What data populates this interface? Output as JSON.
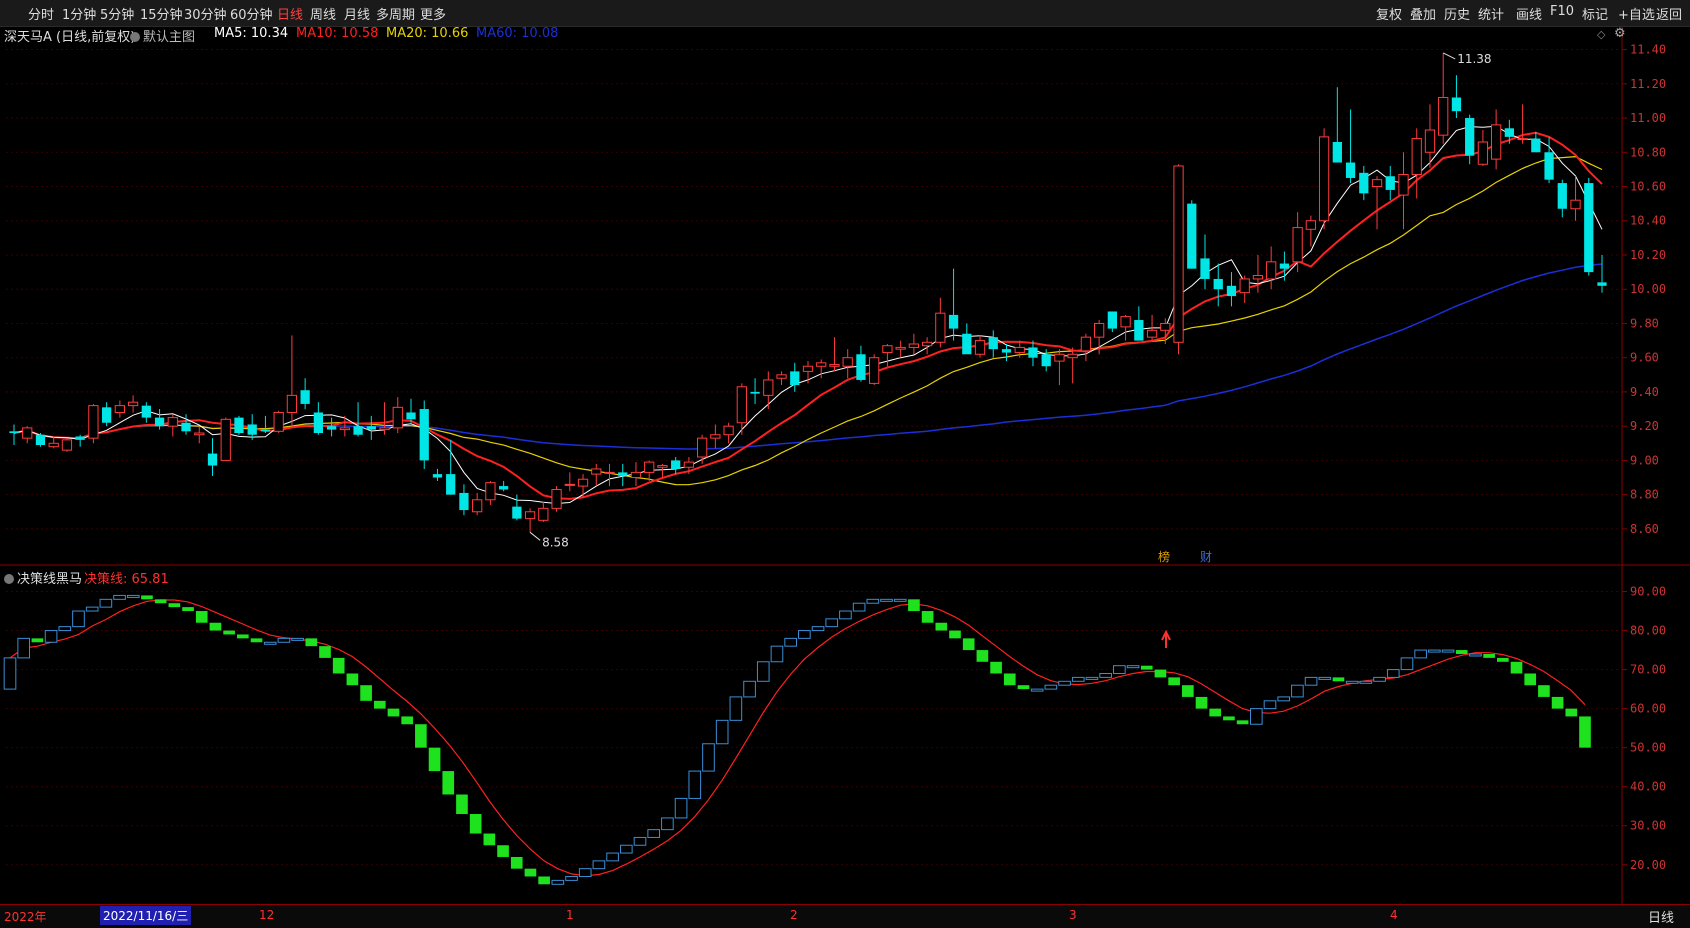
{
  "toolbar": {
    "left": [
      "分时",
      "1分钟",
      "5分钟",
      "15分钟",
      "30分钟",
      "60分钟",
      "日线",
      "周线",
      "月线",
      "多周期",
      "更多"
    ],
    "active": "日线",
    "right": [
      "复权",
      "叠加",
      "历史",
      "统计",
      "画线",
      "F10",
      "标记",
      "+自选",
      "返回"
    ]
  },
  "main": {
    "stock": "深天马A (日线,前复权)",
    "template": "默认主图",
    "ma5": "MA5: 10.34",
    "ma10": "MA10: 10.58",
    "ma20": "MA20: 10.66",
    "ma60": "MA60: 10.08",
    "high_label": "11.38",
    "low_label": "8.58",
    "tag1": "榜",
    "tag2": "财",
    "yticks": [
      "11.40",
      "11.20",
      "11.00",
      "10.80",
      "10.60",
      "10.40",
      "10.20",
      "10.00",
      "9.80",
      "9.60",
      "9.40",
      "9.20",
      "9.00",
      "8.80",
      "8.60"
    ]
  },
  "indicator": {
    "name": "决策线黑马",
    "value": "决策线: 65.81",
    "yticks": [
      "90.00",
      "80.00",
      "70.00",
      "60.00",
      "50.00",
      "40.00",
      "30.00",
      "20.00"
    ]
  },
  "bottom": {
    "year": "2022年",
    "date": "2022/11/16/三",
    "months": [
      "12",
      "1",
      "2",
      "3",
      "4"
    ],
    "period": "日线"
  },
  "colors": {
    "up": "#ff3b3b",
    "down": "#00e5e5",
    "ma5": "#ffffff",
    "ma10": "#ff2020",
    "ma20": "#e6d200",
    "ma60": "#1c2fd6",
    "ind_up": "#3a8fd6",
    "ind_down": "#1ee21e"
  },
  "chart_data": {
    "type": "candlestick",
    "candles": [
      [
        9.17,
        9.21,
        9.09,
        9.16
      ],
      [
        9.13,
        9.2,
        9.1,
        9.19
      ],
      [
        9.15,
        9.16,
        9.08,
        9.09
      ],
      [
        9.08,
        9.14,
        9.07,
        9.1
      ],
      [
        9.06,
        9.13,
        9.05,
        9.12
      ],
      [
        9.14,
        9.15,
        9.08,
        9.12
      ],
      [
        9.13,
        9.33,
        9.1,
        9.32
      ],
      [
        9.31,
        9.34,
        9.2,
        9.22
      ],
      [
        9.28,
        9.35,
        9.25,
        9.32
      ],
      [
        9.32,
        9.38,
        9.28,
        9.34
      ],
      [
        9.32,
        9.34,
        9.22,
        9.25
      ],
      [
        9.25,
        9.3,
        9.18,
        9.2
      ],
      [
        9.2,
        9.27,
        9.14,
        9.25
      ],
      [
        9.22,
        9.27,
        9.15,
        9.17
      ],
      [
        9.15,
        9.2,
        9.1,
        9.16
      ],
      [
        9.04,
        9.13,
        8.91,
        8.97
      ],
      [
        9.0,
        9.25,
        9.0,
        9.24
      ],
      [
        9.25,
        9.26,
        9.15,
        9.16
      ],
      [
        9.21,
        9.27,
        9.12,
        9.15
      ],
      [
        9.18,
        9.26,
        9.16,
        9.17
      ],
      [
        9.17,
        9.29,
        9.16,
        9.28
      ],
      [
        9.28,
        9.73,
        9.2,
        9.38
      ],
      [
        9.41,
        9.48,
        9.3,
        9.33
      ],
      [
        9.28,
        9.34,
        9.15,
        9.16
      ],
      [
        9.2,
        9.25,
        9.14,
        9.18
      ],
      [
        9.18,
        9.26,
        9.14,
        9.19
      ],
      [
        9.2,
        9.34,
        9.14,
        9.15
      ],
      [
        9.2,
        9.26,
        9.12,
        9.18
      ],
      [
        9.18,
        9.34,
        9.15,
        9.19
      ],
      [
        9.19,
        9.37,
        9.16,
        9.31
      ],
      [
        9.28,
        9.36,
        9.22,
        9.24
      ],
      [
        9.3,
        9.35,
        8.95,
        9.0
      ],
      [
        8.92,
        8.95,
        8.88,
        8.9
      ],
      [
        8.92,
        9.12,
        8.8,
        8.8
      ],
      [
        8.81,
        8.86,
        8.68,
        8.71
      ],
      [
        8.7,
        8.81,
        8.68,
        8.77
      ],
      [
        8.77,
        8.88,
        8.74,
        8.87
      ],
      [
        8.85,
        8.88,
        8.82,
        8.83
      ],
      [
        8.73,
        8.8,
        8.65,
        8.66
      ],
      [
        8.66,
        8.72,
        8.58,
        8.7
      ],
      [
        8.65,
        8.76,
        8.64,
        8.72
      ],
      [
        8.72,
        8.85,
        8.7,
        8.83
      ],
      [
        8.86,
        8.93,
        8.82,
        8.86
      ],
      [
        8.85,
        8.92,
        8.78,
        8.89
      ],
      [
        8.92,
        8.98,
        8.85,
        8.95
      ],
      [
        8.93,
        8.98,
        8.85,
        8.93
      ],
      [
        8.93,
        8.98,
        8.85,
        8.91
      ],
      [
        8.9,
        8.99,
        8.85,
        8.93
      ],
      [
        8.93,
        9.0,
        8.88,
        8.99
      ],
      [
        8.96,
        8.98,
        8.9,
        8.97
      ],
      [
        9.0,
        9.02,
        8.92,
        8.95
      ],
      [
        8.96,
        9.02,
        8.92,
        8.99
      ],
      [
        9.02,
        9.15,
        8.98,
        9.13
      ],
      [
        9.13,
        9.21,
        9.07,
        9.15
      ],
      [
        9.15,
        9.22,
        9.1,
        9.2
      ],
      [
        9.22,
        9.45,
        9.15,
        9.43
      ],
      [
        9.4,
        9.48,
        9.33,
        9.39
      ],
      [
        9.38,
        9.52,
        9.3,
        9.47
      ],
      [
        9.48,
        9.52,
        9.44,
        9.5
      ],
      [
        9.52,
        9.57,
        9.4,
        9.44
      ],
      [
        9.52,
        9.58,
        9.45,
        9.55
      ],
      [
        9.55,
        9.59,
        9.48,
        9.57
      ],
      [
        9.55,
        9.72,
        9.52,
        9.56
      ],
      [
        9.55,
        9.65,
        9.48,
        9.6
      ],
      [
        9.62,
        9.67,
        9.46,
        9.47
      ],
      [
        9.45,
        9.62,
        9.44,
        9.6
      ],
      [
        9.63,
        9.68,
        9.55,
        9.67
      ],
      [
        9.65,
        9.7,
        9.6,
        9.66
      ],
      [
        9.66,
        9.74,
        9.62,
        9.68
      ],
      [
        9.67,
        9.72,
        9.62,
        9.69
      ],
      [
        9.69,
        9.95,
        9.66,
        9.86
      ],
      [
        9.85,
        10.12,
        9.7,
        9.77
      ],
      [
        9.74,
        9.8,
        9.64,
        9.62
      ],
      [
        9.62,
        9.73,
        9.6,
        9.7
      ],
      [
        9.72,
        9.76,
        9.6,
        9.65
      ],
      [
        9.65,
        9.68,
        9.58,
        9.63
      ],
      [
        9.63,
        9.7,
        9.6,
        9.66
      ],
      [
        9.66,
        9.7,
        9.55,
        9.6
      ],
      [
        9.62,
        9.65,
        9.52,
        9.55
      ],
      [
        9.58,
        9.65,
        9.44,
        9.62
      ],
      [
        9.6,
        9.66,
        9.45,
        9.62
      ],
      [
        9.64,
        9.74,
        9.58,
        9.72
      ],
      [
        9.72,
        9.82,
        9.62,
        9.8
      ],
      [
        9.87,
        9.87,
        9.75,
        9.77
      ],
      [
        9.78,
        9.85,
        9.7,
        9.84
      ],
      [
        9.82,
        9.9,
        9.7,
        9.7
      ],
      [
        9.72,
        9.85,
        9.7,
        9.76
      ],
      [
        9.76,
        9.83,
        9.68,
        9.8
      ],
      [
        9.69,
        10.73,
        9.62,
        10.72
      ],
      [
        10.5,
        10.52,
        10.12,
        10.12
      ],
      [
        10.18,
        10.32,
        10.0,
        10.06
      ],
      [
        10.06,
        10.15,
        9.9,
        10.0
      ],
      [
        10.02,
        10.1,
        9.9,
        9.96
      ],
      [
        9.98,
        10.08,
        9.92,
        10.06
      ],
      [
        10.06,
        10.2,
        9.98,
        10.08
      ],
      [
        10.06,
        10.25,
        10.0,
        10.16
      ],
      [
        10.15,
        10.22,
        10.05,
        10.12
      ],
      [
        10.16,
        10.45,
        10.1,
        10.36
      ],
      [
        10.35,
        10.43,
        10.25,
        10.4
      ],
      [
        10.4,
        10.94,
        10.35,
        10.89
      ],
      [
        10.86,
        11.18,
        10.78,
        10.74
      ],
      [
        10.74,
        11.05,
        10.62,
        10.65
      ],
      [
        10.68,
        10.72,
        10.52,
        10.56
      ],
      [
        10.6,
        10.66,
        10.35,
        10.64
      ],
      [
        10.66,
        10.72,
        10.52,
        10.58
      ],
      [
        10.55,
        10.8,
        10.35,
        10.67
      ],
      [
        10.67,
        10.94,
        10.53,
        10.88
      ],
      [
        10.8,
        11.08,
        10.71,
        10.93
      ],
      [
        10.9,
        11.38,
        10.85,
        11.12
      ],
      [
        11.12,
        11.25,
        11.0,
        11.04
      ],
      [
        11.0,
        11.02,
        10.73,
        10.78
      ],
      [
        10.73,
        10.93,
        10.72,
        10.86
      ],
      [
        10.76,
        11.05,
        10.7,
        10.96
      ],
      [
        10.94,
        10.99,
        10.85,
        10.89
      ],
      [
        10.88,
        11.08,
        10.85,
        10.88
      ],
      [
        10.88,
        10.92,
        10.82,
        10.8
      ],
      [
        10.8,
        10.89,
        10.62,
        10.64
      ],
      [
        10.62,
        10.64,
        10.42,
        10.47
      ],
      [
        10.47,
        10.66,
        10.4,
        10.52
      ],
      [
        10.62,
        10.65,
        10.08,
        10.1
      ],
      [
        10.04,
        10.2,
        9.98,
        10.02
      ]
    ],
    "indicator": {
      "open": [
        65,
        73,
        78,
        77,
        80,
        81,
        85,
        86,
        88,
        89,
        89,
        88,
        87,
        86,
        85,
        82,
        80,
        79,
        78,
        77,
        77,
        78,
        78,
        76,
        73,
        69,
        66,
        62,
        60,
        58,
        56,
        50,
        44,
        38,
        33,
        28,
        25,
        22,
        19,
        17,
        15,
        16,
        17,
        19,
        21,
        23,
        25,
        27,
        29,
        32,
        37,
        44,
        51,
        57,
        63,
        67,
        72,
        76,
        78,
        80,
        81,
        83,
        85,
        87,
        88,
        88,
        88,
        85,
        82,
        80,
        78,
        75,
        72,
        69,
        66,
        65,
        65,
        66,
        67,
        68,
        68,
        69,
        71,
        71,
        70,
        68,
        66,
        63,
        60,
        58,
        57,
        56,
        60,
        62,
        63,
        66,
        68,
        68,
        67,
        67,
        67,
        68,
        70,
        73,
        75,
        75,
        75,
        74,
        74,
        73,
        72,
        69,
        66,
        63,
        60,
        58
      ],
      "close": [
        73,
        78,
        77,
        80,
        81,
        85,
        86,
        88,
        89,
        89,
        88,
        87,
        86,
        85,
        82,
        80,
        79,
        78,
        77,
        77,
        78,
        78,
        76,
        73,
        69,
        66,
        62,
        60,
        58,
        56,
        50,
        44,
        38,
        33,
        28,
        25,
        22,
        19,
        17,
        15,
        16,
        17,
        19,
        21,
        23,
        25,
        27,
        29,
        32,
        37,
        44,
        51,
        57,
        63,
        67,
        72,
        76,
        78,
        80,
        81,
        83,
        85,
        87,
        88,
        88,
        88,
        85,
        82,
        80,
        78,
        75,
        72,
        69,
        66,
        65,
        65,
        66,
        67,
        68,
        68,
        69,
        71,
        71,
        70,
        68,
        66,
        63,
        60,
        58,
        57,
        56,
        60,
        62,
        63,
        66,
        68,
        68,
        67,
        67,
        67,
        68,
        70,
        73,
        75,
        75,
        75,
        74,
        74,
        73,
        72,
        69,
        66,
        63,
        60,
        58,
        50
      ]
    }
  }
}
